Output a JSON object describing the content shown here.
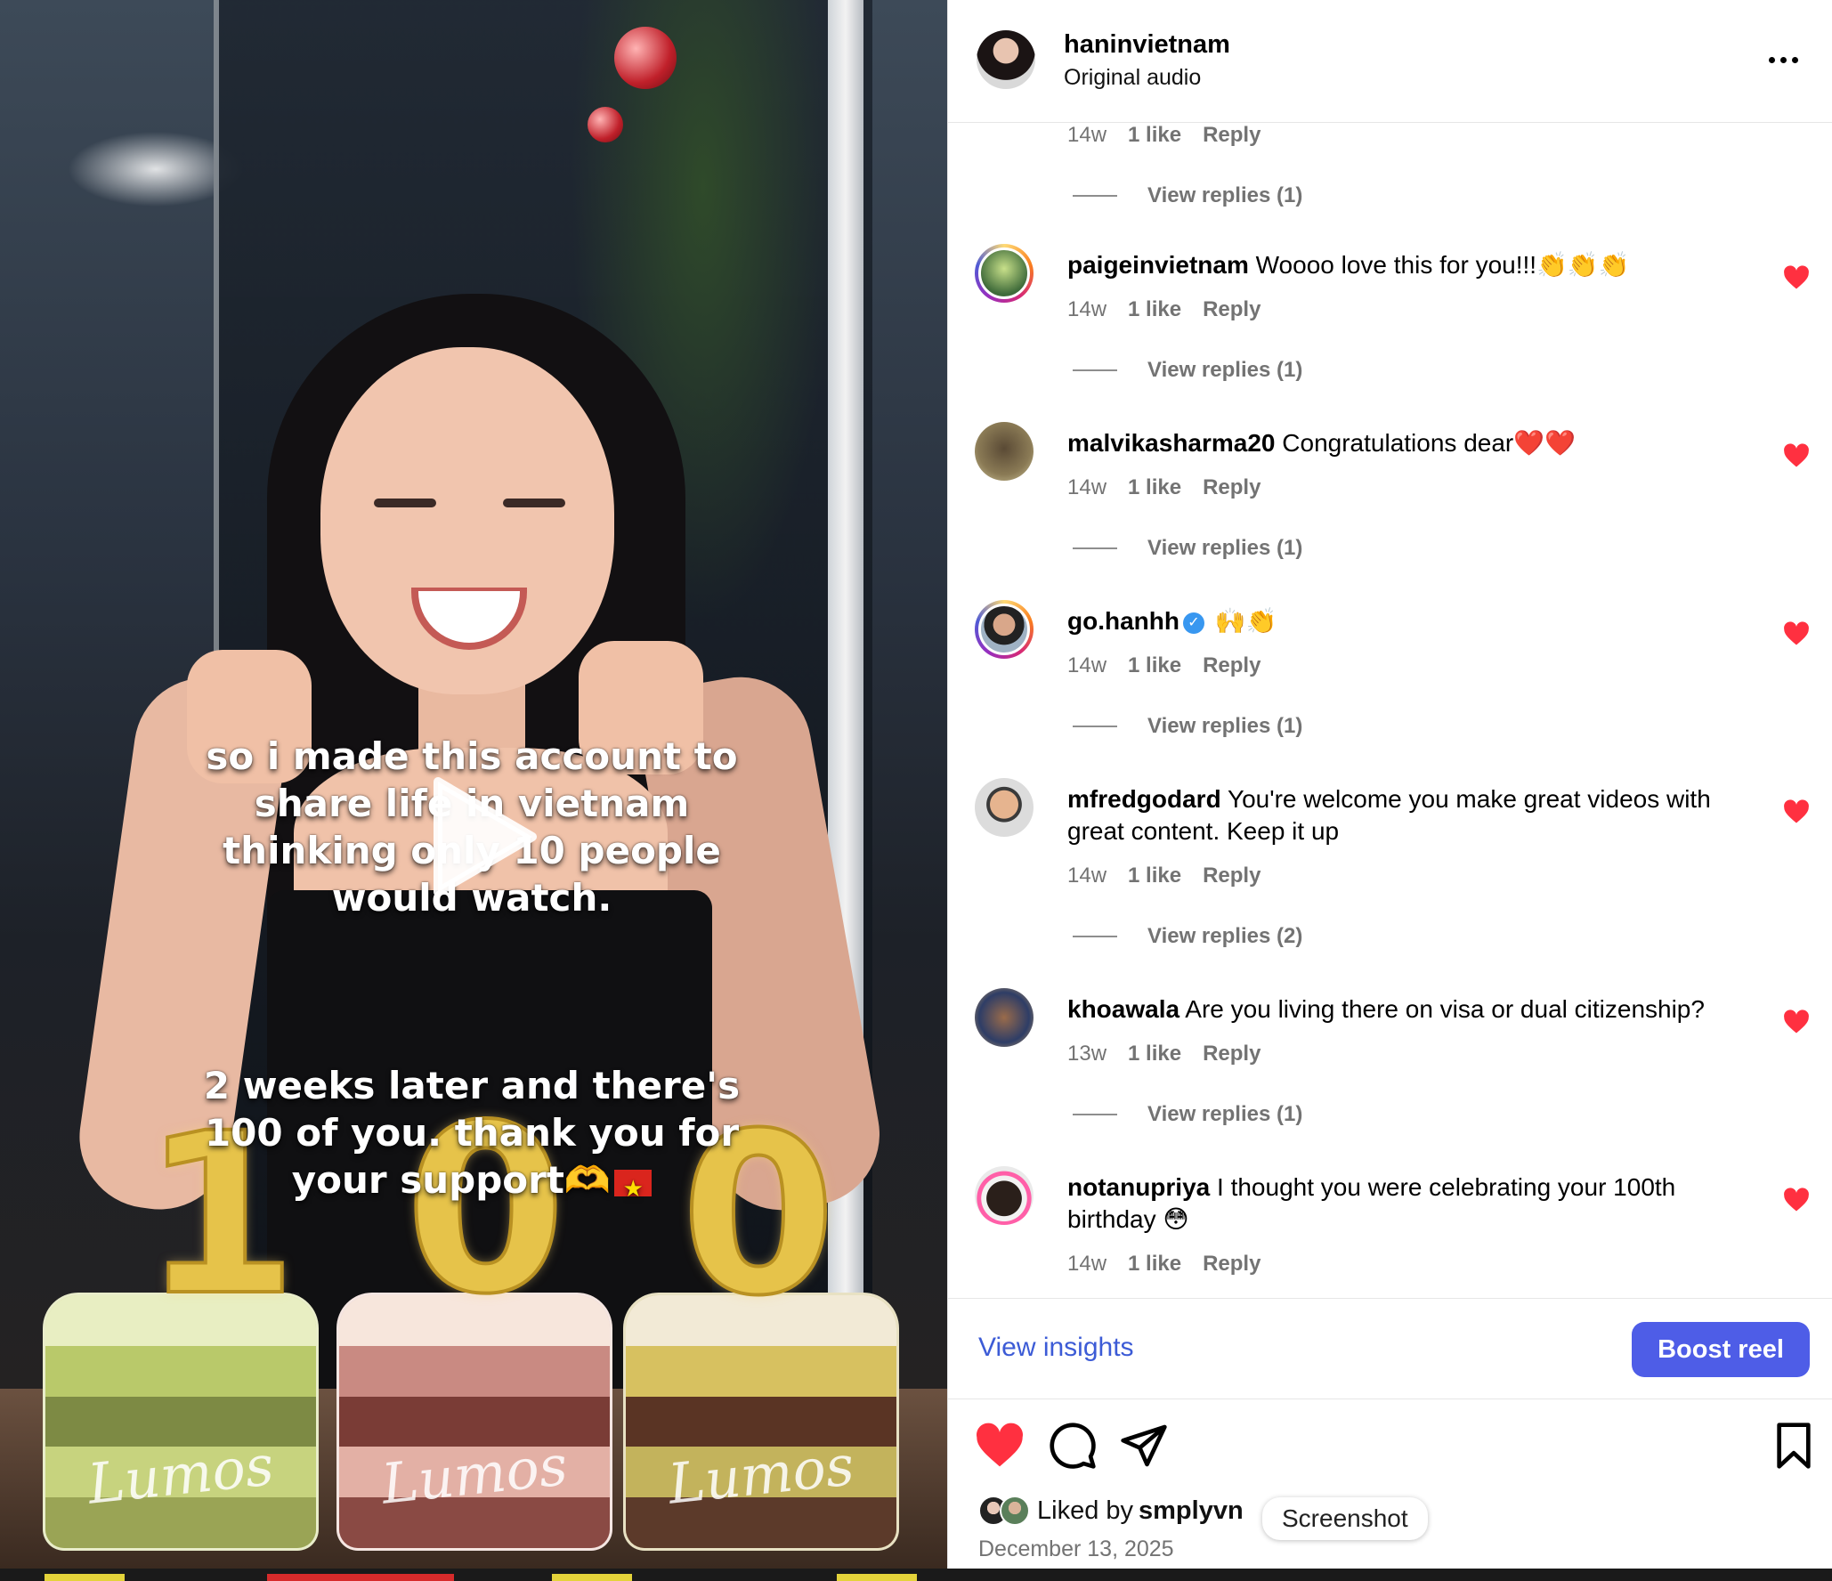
{
  "header": {
    "username": "haninvietnam",
    "audio": "Original audio",
    "more_icon": "more-horizontal-icon"
  },
  "video": {
    "caption_line1": "so i made this account to\nshare life in vietnam\nthinking only 10 people\nwould watch.",
    "caption_line2": "2 weeks later and there's\n100 of you. thank you for\nyour support",
    "candle_1": "1",
    "candle_2": "0",
    "candle_3": "0",
    "cake_brand": "Lumos",
    "play_icon": "play-icon"
  },
  "comments": {
    "top_partial": {
      "time": "14w",
      "likes": "1 like",
      "reply": "Reply",
      "view_replies": "View replies (1)"
    },
    "items": [
      {
        "user": "paigeinvietnam",
        "text": "Woooo love this for you!!!👏👏👏",
        "time": "14w",
        "likes": "1 like",
        "reply": "Reply",
        "view_replies": "View replies (1)",
        "verified": false
      },
      {
        "user": "malvikasharma20",
        "text": "Congratulations dear❤️❤️",
        "time": "14w",
        "likes": "1 like",
        "reply": "Reply",
        "view_replies": "View replies (1)",
        "verified": false
      },
      {
        "user": "go.hanhh",
        "text": "🙌👏",
        "time": "14w",
        "likes": "1 like",
        "reply": "Reply",
        "view_replies": "View replies (1)",
        "verified": true
      },
      {
        "user": "mfredgodard",
        "text": "You're welcome you make great videos with great content. Keep it up",
        "time": "14w",
        "likes": "1 like",
        "reply": "Reply",
        "view_replies": "View replies (2)",
        "verified": false
      },
      {
        "user": "khoawala",
        "text": "Are you living there on visa or dual citizenship?",
        "time": "13w",
        "likes": "1 like",
        "reply": "Reply",
        "view_replies": "View replies (1)",
        "verified": false
      },
      {
        "user": "notanupriya",
        "text": "I thought you were celebrating your 100th birthday 😳",
        "time": "14w",
        "likes": "1 like",
        "reply": "Reply",
        "view_replies": "",
        "verified": false
      }
    ]
  },
  "actions": {
    "view_insights": "View insights",
    "boost": "Boost reel"
  },
  "footer": {
    "liked_prefix": "Liked by",
    "liked_name": "smplyvn",
    "date": "December 13, 2025",
    "tooltip": "Screenshot"
  },
  "colors": {
    "accent": "#4e5de7",
    "link": "#3c5bd6",
    "heart": "#ff3040",
    "muted": "#737373"
  }
}
